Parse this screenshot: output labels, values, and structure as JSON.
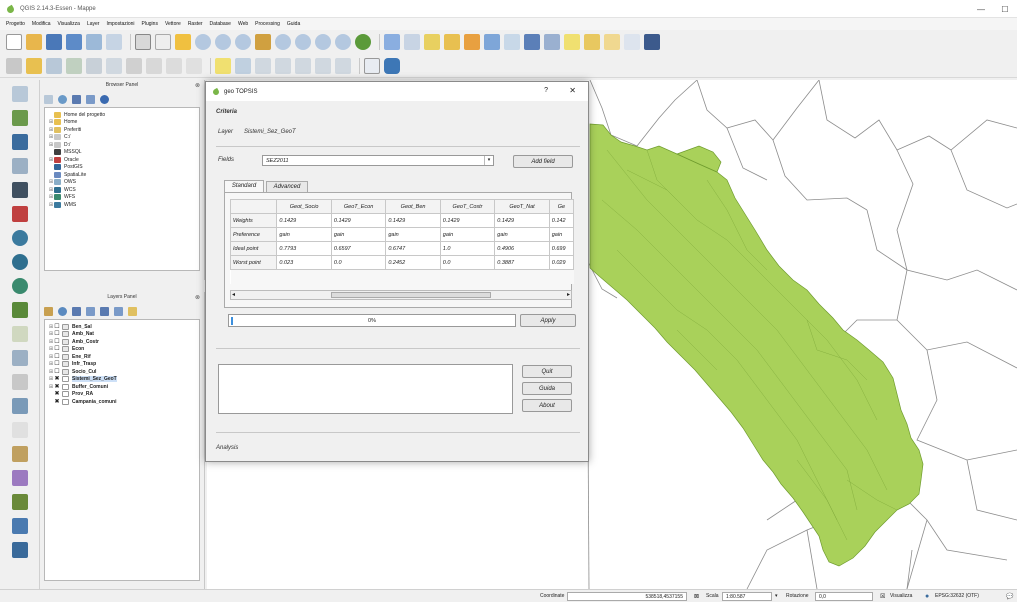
{
  "window": {
    "title": "QGIS 2.14.3-Essen - Mappe",
    "min": "—",
    "max": "☐"
  },
  "menus": [
    "Progetto",
    "Modifica",
    "Visualizza",
    "Layer",
    "Impostazioni",
    "Plugins",
    "Vettore",
    "Raster",
    "Database",
    "Web",
    "Processing",
    "Guida"
  ],
  "browser_panel": {
    "title": "Browser Panel",
    "items": [
      "Home del progetto",
      "Home",
      "Preferiti",
      "C:/",
      "D:/",
      "MSSQL",
      "Oracle",
      "PostGIS",
      "SpatiaLite",
      "OWS",
      "WCS",
      "WFS",
      "WMS"
    ]
  },
  "layers_panel": {
    "title": "Layers Panel",
    "items": [
      "Ben_Sal",
      "Amb_Nat",
      "Amb_Costr",
      "Econ",
      "Ene_Rif",
      "Infr_Trasp",
      "Socio_Cul",
      "Sistemi_Sez_GeoT",
      "Buffer_Comuni",
      "Prov_RA",
      "Campania_comuni"
    ]
  },
  "dialog": {
    "title": "geo TOPSIS",
    "help": "?",
    "close": "✕",
    "section": "Criteria",
    "layer_label": "Layer",
    "layer_value": "Sistemi_Sez_GeoT",
    "fields_label": "Fields",
    "fields_value": "SEZ2011",
    "add_field": "Add field",
    "tabs": [
      "Standard",
      "Advanced"
    ],
    "columns": [
      "Geot_Socio",
      "GeoT_Econ",
      "Geot_Ben",
      "GeoT_Costr",
      "GeoT_Nat",
      "Ge"
    ],
    "rows": [
      {
        "label": "Weights",
        "cells": [
          "0.1429",
          "0.1429",
          "0.1429",
          "0.1429",
          "0.1429",
          "0.142"
        ]
      },
      {
        "label": "Preference",
        "cells": [
          "gain",
          "gain",
          "gain",
          "gain",
          "gain",
          "gain"
        ]
      },
      {
        "label": "Ideal point",
        "cells": [
          "0.7793",
          "0.6597",
          "0.6747",
          "1.0",
          "0.4906",
          "0.699"
        ]
      },
      {
        "label": "Worst point",
        "cells": [
          "0.023",
          "0.0",
          "0.2452",
          "0.0",
          "0.3887",
          "0.029"
        ]
      }
    ],
    "progress_text": "0%",
    "progress": 0,
    "apply": "Apply",
    "quit": "Quit",
    "guida": "Guida",
    "about": "About",
    "footer": "Analysis"
  },
  "statusbar": {
    "coord_label": "Coordinate",
    "coord_value": "538518,4537155",
    "scale_label": "Scala",
    "scale_value": "1:80.587",
    "rotation_label": "Rotazione",
    "rotation_value": "0,0",
    "render_label": "Visualizza",
    "crs": "EPSG:32632 (OTF)"
  },
  "colors": {
    "map_fill": "#a9d15a",
    "map_stroke": "#6f9c2e",
    "boundary": "#8c8c8c"
  }
}
